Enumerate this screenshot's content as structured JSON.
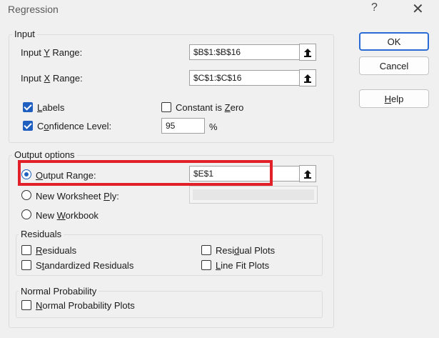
{
  "window": {
    "title": "Regression",
    "help_glyph": "?",
    "close_glyph": "✕"
  },
  "input": {
    "legend": "Input",
    "y_range": {
      "label_pre": "Input ",
      "label_u": "Y",
      "label_post": " Range:",
      "value": "$B$1:$B$16"
    },
    "x_range": {
      "label_pre": "Input ",
      "label_u": "X",
      "label_post": " Range:",
      "value": "$C$1:$C$16"
    },
    "labels": {
      "label_u": "L",
      "label_rest": "abels",
      "checked": true
    },
    "constant_zero": {
      "label_pre": "Constant is ",
      "label_u": "Z",
      "label_post": "ero",
      "checked": false
    },
    "confidence": {
      "label_pre": "C",
      "label_u": "o",
      "label_post": "nfidence Level:",
      "value": "95",
      "unit": "%",
      "checked": true
    }
  },
  "output": {
    "legend": "Output options",
    "output_range": {
      "label_pre": "",
      "label_u": "O",
      "label_post": "utput Range:",
      "value": "$E$1",
      "selected": true
    },
    "new_worksheet": {
      "label_pre": "New Worksheet ",
      "label_u": "P",
      "label_post": "ly:",
      "selected": false
    },
    "new_workbook": {
      "label_pre": "New ",
      "label_u": "W",
      "label_post": "orkbook",
      "selected": false
    }
  },
  "residuals": {
    "legend": "Residuals",
    "residuals": {
      "label_u": "R",
      "label_rest": "esiduals"
    },
    "standardized": {
      "label_pre": "S",
      "label_u": "t",
      "label_post": "andardized Residuals"
    },
    "residual_plots": {
      "label_pre": "Resi",
      "label_u": "d",
      "label_post": "ual Plots"
    },
    "line_fit": {
      "label_u": "L",
      "label_pre": "",
      "label_post": "ine Fit Plots",
      "label_u2": ""
    }
  },
  "normal": {
    "legend": "Normal Probability",
    "plots": {
      "label_u": "N",
      "label_rest": "ormal Probability Plots"
    }
  },
  "buttons": {
    "ok": "OK",
    "cancel": "Cancel",
    "help_pre": "",
    "help_u": "H",
    "help_post": "elp"
  }
}
